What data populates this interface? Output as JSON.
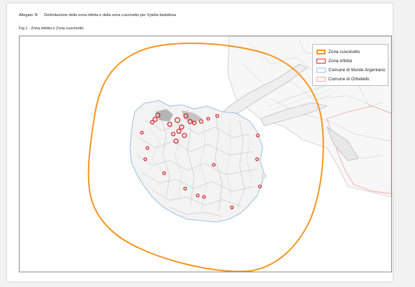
{
  "document": {
    "header_title": "Allegato 'A'",
    "header_text": "Delimitazione della zona infetta e della zona cuscinetto per Xylella fastidiosa",
    "figure_caption": "Fig.1 - Zona infetta e Zona cuscinetto"
  },
  "map": {
    "legend": [
      {
        "label": "Zona cuscinetto",
        "color": "#f7941d",
        "style": "thick-border"
      },
      {
        "label": "Zona infetta",
        "color": "#d7262b",
        "style": "border"
      },
      {
        "label": "Comune di Monte Argentario",
        "color": "#9fc3e6",
        "style": "border"
      },
      {
        "label": "Comune di Orbetello",
        "color": "#f4a9a8",
        "style": "border"
      }
    ],
    "colors": {
      "buffer_zone": "#f7941d",
      "infected_zone": "#d7262b",
      "monte_argentario": "#9fc3e6",
      "orbetello": "#f4a9a8",
      "terrain": "#9a9a9a"
    }
  }
}
